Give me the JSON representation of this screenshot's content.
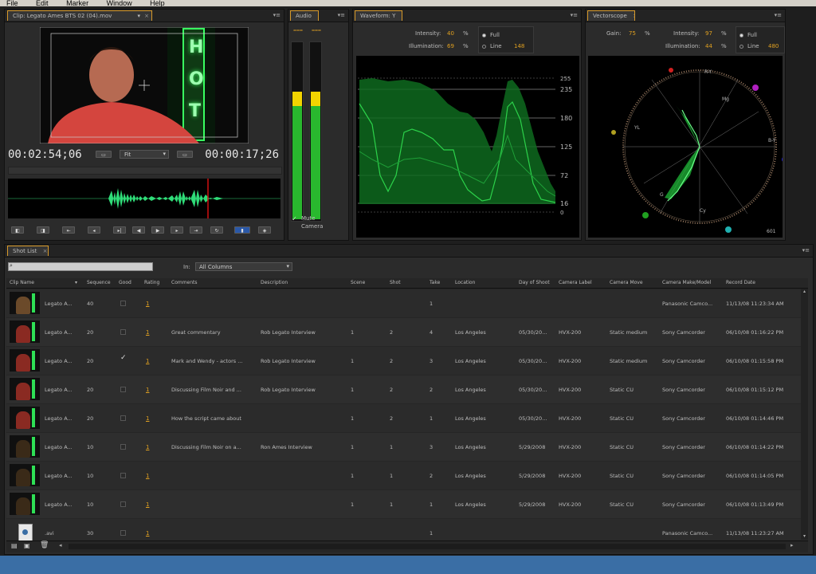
{
  "menu": [
    "File",
    "Edit",
    "Marker",
    "Window",
    "Help"
  ],
  "monitor": {
    "tab_label": "Clip: Legato Ames BTS 02 (04).mov",
    "timecode_current": "00:02:54;06",
    "timecode_duration": "00:00:17;26",
    "zoom": "Fit",
    "neon_sign": "HOT"
  },
  "audio": {
    "tab_label": "Audio",
    "mute_label": "Mute",
    "camera_label": "Camera",
    "mute_checked": true,
    "meter_levels": [
      0.72,
      0.72
    ],
    "meter_colors": {
      "green": "#29b82e",
      "yellow": "#f2d400"
    }
  },
  "waveform": {
    "tab_label": "Waveform: Y",
    "intensity_label": "Intensity:",
    "intensity_value": "40",
    "illumination_label": "Illumination:",
    "illumination_value": "69",
    "percent": "%",
    "full_label": "Full",
    "line_label": "Line",
    "line_value": "148",
    "scale": [
      "255",
      "235",
      "180",
      "125",
      "72",
      "16",
      "0"
    ]
  },
  "vectorscope": {
    "tab_label": "Vectorscope",
    "gain_label": "Gain:",
    "gain_value": "75",
    "intensity_label": "Intensity:",
    "intensity_value": "97",
    "illumination_label": "Illumination:",
    "illumination_value": "44",
    "percent": "%",
    "full_label": "Full",
    "line_label": "Line",
    "line_value": "480",
    "axis_labels": {
      "ry": "R-Y",
      "by": "B-Y",
      "mg": "Mg",
      "cy": "Cy",
      "yl": "YL",
      "g": "G"
    },
    "corner_value": "601",
    "target_colors": {
      "red": "#d02020",
      "magenta": "#b020c0",
      "blue": "#2020d0",
      "cyan": "#20b0b0",
      "green": "#20a020",
      "yellow": "#b0a020"
    }
  },
  "shotlist": {
    "tab_label": "Shot List",
    "search_placeholder": "",
    "in_label": "In:",
    "in_value": "All Columns",
    "columns": [
      "Clip Name",
      "Sequence",
      "Good",
      "Rating",
      "Comments",
      "Description",
      "Scene",
      "Shot",
      "Take",
      "Location",
      "Day of Shoot",
      "Camera Label",
      "Camera Move",
      "Camera Make/Model",
      "Record Date"
    ],
    "rows": [
      {
        "clip": "Legato A...",
        "seq": "40",
        "good": false,
        "rating": "1",
        "comments": "",
        "desc": "",
        "scene": "",
        "shot": "",
        "take": "1",
        "location": "",
        "day": "",
        "cam_label": "",
        "cam_move": "",
        "cam_model": "Panasonic Camco...",
        "record": "11/13/08  11:23:34 AM"
      },
      {
        "clip": "Legato A...",
        "seq": "20",
        "good": false,
        "rating": "1",
        "comments": "Great commentary",
        "desc": "Rob Legato Interview",
        "scene": "1",
        "shot": "2",
        "take": "4",
        "location": "Los Angeles",
        "day": "05/30/20...",
        "cam_label": "HVX-200",
        "cam_move": "Static medium",
        "cam_model": "Sony Camcorder",
        "record": "06/10/08  01:16:22 PM"
      },
      {
        "clip": "Legato A...",
        "seq": "20",
        "good": true,
        "rating": "1",
        "comments": "Mark and Wendy - actors ...",
        "desc": "Rob Legato Interview",
        "scene": "1",
        "shot": "2",
        "take": "3",
        "location": "Los Angeles",
        "day": "05/30/20...",
        "cam_label": "HVX-200",
        "cam_move": "Static medium",
        "cam_model": "Sony Camcorder",
        "record": "06/10/08  01:15:58 PM"
      },
      {
        "clip": "Legato A...",
        "seq": "20",
        "good": false,
        "rating": "1",
        "comments": "Discussing Film Noir and ...",
        "desc": "Rob Legato Interview",
        "scene": "1",
        "shot": "2",
        "take": "2",
        "location": "Los Angeles",
        "day": "05/30/20...",
        "cam_label": "HVX-200",
        "cam_move": "Static CU",
        "cam_model": "Sony Camcorder",
        "record": "06/10/08  01:15:12 PM"
      },
      {
        "clip": "Legato A...",
        "seq": "20",
        "good": false,
        "rating": "1",
        "comments": "How the script came about",
        "desc": "",
        "scene": "1",
        "shot": "2",
        "take": "1",
        "location": "Los Angeles",
        "day": "05/30/20...",
        "cam_label": "HVX-200",
        "cam_move": "Static CU",
        "cam_model": "Sony Camcorder",
        "record": "06/10/08  01:14:46 PM"
      },
      {
        "clip": "Legato A...",
        "seq": "10",
        "good": false,
        "rating": "1",
        "comments": " Discussing Film Noir on a...",
        "desc": "Ron Ames Interview",
        "scene": "1",
        "shot": "1",
        "take": "3",
        "location": "Los Angeles",
        "day": "5/29/2008",
        "cam_label": "HVX-200",
        "cam_move": "Static CU",
        "cam_model": "Sony Camcorder",
        "record": "06/10/08  01:14:22 PM"
      },
      {
        "clip": "Legato A...",
        "seq": "10",
        "good": false,
        "rating": "1",
        "comments": "",
        "desc": "",
        "scene": "1",
        "shot": "1",
        "take": "2",
        "location": "Los Angeles",
        "day": "5/29/2008",
        "cam_label": "HVX-200",
        "cam_move": "Static CU",
        "cam_model": "Sony Camcorder",
        "record": "06/10/08  01:14:05 PM"
      },
      {
        "clip": "Legato A...",
        "seq": "10",
        "good": false,
        "rating": "1",
        "comments": "",
        "desc": "",
        "scene": "1",
        "shot": "1",
        "take": "1",
        "location": "Los Angeles",
        "day": "5/29/2008",
        "cam_label": "HVX-200",
        "cam_move": "Static CU",
        "cam_model": "Sony Camcorder",
        "record": "06/10/08  01:13:49 PM"
      },
      {
        "clip": ".avi",
        "seq": "30",
        "good": false,
        "rating": "1",
        "comments": "",
        "desc": "",
        "scene": "",
        "shot": "",
        "take": "1",
        "location": "",
        "day": "",
        "cam_label": "",
        "cam_move": "",
        "cam_model": "Panasonic Camco...",
        "record": "11/13/08  11:23:27 AM"
      }
    ]
  }
}
